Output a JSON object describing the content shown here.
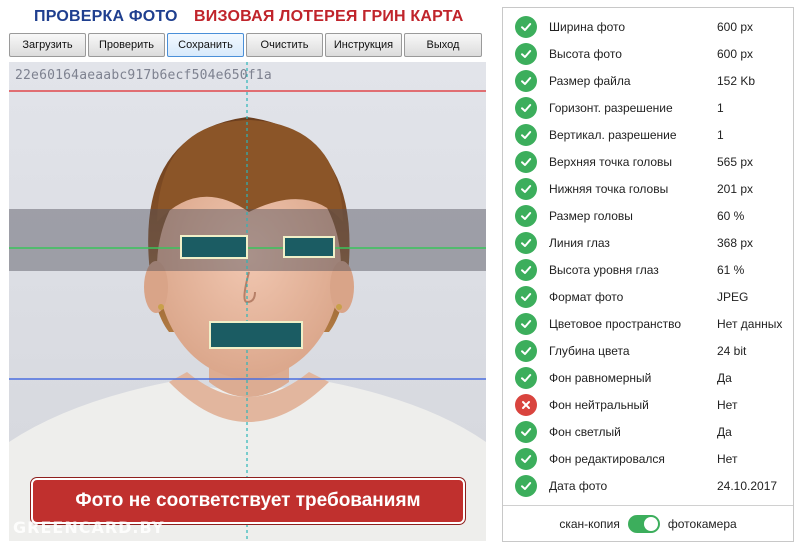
{
  "header": {
    "title_left": "ПРОВЕРКА ФОТО",
    "title_right": "ВИЗОВАЯ ЛОТЕРЕЯ ГРИН КАРТА"
  },
  "toolbar": {
    "buttons": [
      {
        "label": "Загрузить",
        "name": "upload-button"
      },
      {
        "label": "Проверить",
        "name": "check-button"
      },
      {
        "label": "Сохранить",
        "name": "save-button",
        "active": true
      },
      {
        "label": "Очистить",
        "name": "clear-button"
      },
      {
        "label": "Инструкция",
        "name": "instruction-button"
      },
      {
        "label": "Выход",
        "name": "exit-button"
      }
    ]
  },
  "photo": {
    "hash": "22e60164aeaabc917b6ecf504e650f1a",
    "result_banner": "Фото не соответствует требованиям",
    "watermark": "GREENCARD.BY"
  },
  "checks": [
    {
      "label": "Ширина фото",
      "value": "600 px",
      "status": "ok"
    },
    {
      "label": "Высота фото",
      "value": "600 px",
      "status": "ok"
    },
    {
      "label": "Размер файла",
      "value": "152 Kb",
      "status": "ok"
    },
    {
      "label": "Горизонт. разрешение",
      "value": "1",
      "status": "ok"
    },
    {
      "label": "Вертикал. разрешение",
      "value": "1",
      "status": "ok"
    },
    {
      "label": "Верхняя точка головы",
      "value": "565 px",
      "status": "ok"
    },
    {
      "label": "Нижняя точка головы",
      "value": "201 px",
      "status": "ok"
    },
    {
      "label": "Размер головы",
      "value": "60 %",
      "status": "ok"
    },
    {
      "label": "Линия глаз",
      "value": "368 px",
      "status": "ok"
    },
    {
      "label": "Высота уровня глаз",
      "value": "61 %",
      "status": "ok"
    },
    {
      "label": "Формат фото",
      "value": "JPEG",
      "status": "ok"
    },
    {
      "label": "Цветовое пространство",
      "value": "Нет данных",
      "status": "ok"
    },
    {
      "label": "Глубина цвета",
      "value": "24 bit",
      "status": "ok"
    },
    {
      "label": "Фон равномерный",
      "value": "Да",
      "status": "ok"
    },
    {
      "label": "Фон нейтральный",
      "value": "Нет",
      "status": "fail"
    },
    {
      "label": "Фон светлый",
      "value": "Да",
      "status": "ok"
    },
    {
      "label": "Фон редактировался",
      "value": "Нет",
      "status": "ok"
    },
    {
      "label": "Дата фото",
      "value": "24.10.2017",
      "status": "ok"
    }
  ],
  "source_toggle": {
    "left_label": "скан-копия",
    "right_label": "фотокамера",
    "selected": "фотокамера"
  },
  "colors": {
    "ok": "#3cae5c",
    "fail": "#d9443e",
    "title_blue": "#1f3f8f",
    "title_red": "#c0242b",
    "banner": "#c0302e"
  }
}
